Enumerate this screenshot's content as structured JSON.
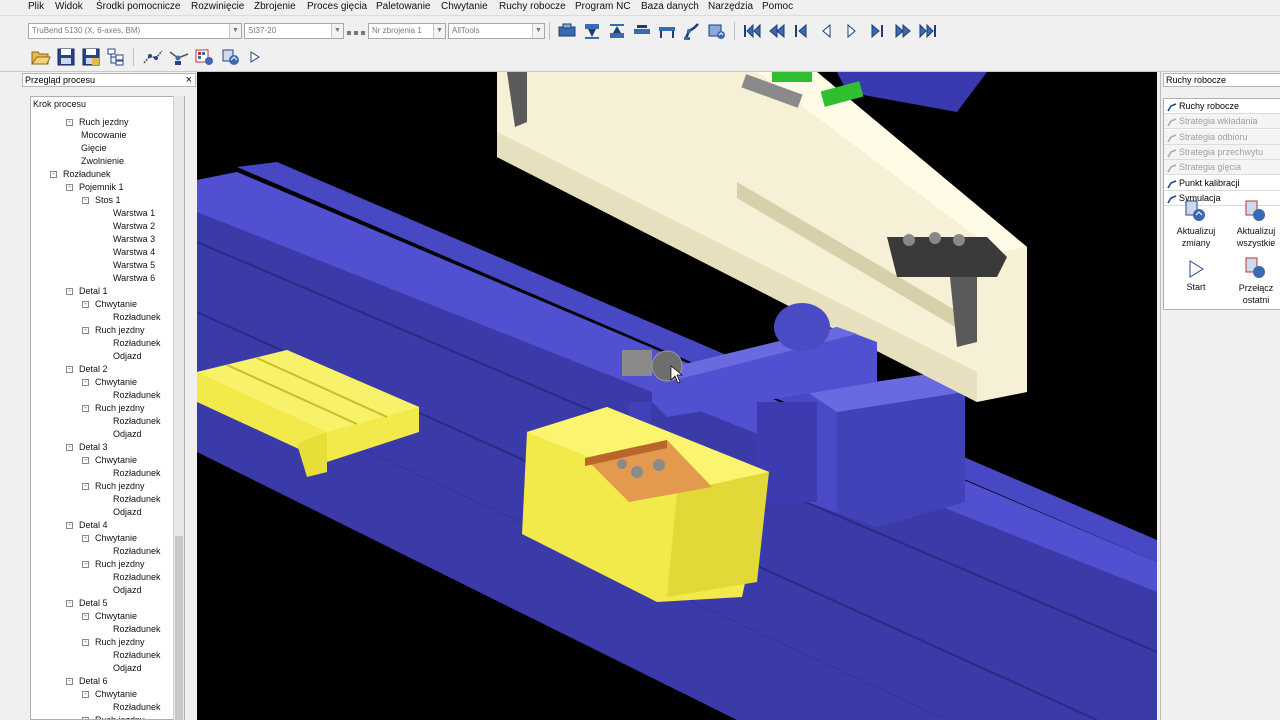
{
  "menu": [
    "Plik",
    "Widok",
    "Środki pomocnicze",
    "Rozwinięcie",
    "Zbrojenie",
    "Proces gięcia",
    "Paletowanie",
    "Chwytanie",
    "Ruchy robocze",
    "Program NC",
    "Baza danych",
    "Narzędzia",
    "Pomoc"
  ],
  "toolbar": {
    "machine_select": "TruBend 5130 (X, 6-axes, BM)",
    "material_select": "St37-20",
    "tooling_number": "Nr zbrojenia 1",
    "tools_select": "AllTools"
  },
  "left_panel": {
    "title": "Przegląd procesu",
    "tree_header": "Krok procesu",
    "tree": [
      {
        "label": "Ruch jezdny",
        "level": 2,
        "toggle": "-"
      },
      {
        "label": "Mocowanie",
        "level": 3
      },
      {
        "label": "Gięcie",
        "level": 3
      },
      {
        "label": "Zwolnienie",
        "level": 3
      },
      {
        "label": "Rozładunek",
        "level": 1,
        "toggle": "-"
      },
      {
        "label": "Pojemnik 1",
        "level": 2,
        "toggle": "-"
      },
      {
        "label": "Stos 1",
        "level": 3,
        "toggle": "-"
      },
      {
        "label": "Warstwa 1",
        "level": 4
      },
      {
        "label": "Warstwa 2",
        "level": 4
      },
      {
        "label": "Warstwa 3",
        "level": 4
      },
      {
        "label": "Warstwa 4",
        "level": 4
      },
      {
        "label": "Warstwa 5",
        "level": 4
      },
      {
        "label": "Warstwa 6",
        "level": 4
      },
      {
        "label": "Detal 1",
        "level": 2,
        "toggle": "-"
      },
      {
        "label": "Chwytanie",
        "level": 3,
        "toggle": "-"
      },
      {
        "label": "Rozładunek",
        "level": 4
      },
      {
        "label": "Ruch jezdny",
        "level": 3,
        "toggle": "-"
      },
      {
        "label": "Rozładunek",
        "level": 4
      },
      {
        "label": "Odjazd",
        "level": 4
      },
      {
        "label": "Detal 2",
        "level": 2,
        "toggle": "-"
      },
      {
        "label": "Chwytanie",
        "level": 3,
        "toggle": "-"
      },
      {
        "label": "Rozładunek",
        "level": 4
      },
      {
        "label": "Ruch jezdny",
        "level": 3,
        "toggle": "-"
      },
      {
        "label": "Rozładunek",
        "level": 4
      },
      {
        "label": "Odjazd",
        "level": 4
      },
      {
        "label": "Detal 3",
        "level": 2,
        "toggle": "-"
      },
      {
        "label": "Chwytanie",
        "level": 3,
        "toggle": "-"
      },
      {
        "label": "Rozładunek",
        "level": 4
      },
      {
        "label": "Ruch jezdny",
        "level": 3,
        "toggle": "-"
      },
      {
        "label": "Rozładunek",
        "level": 4
      },
      {
        "label": "Odjazd",
        "level": 4
      },
      {
        "label": "Detal 4",
        "level": 2,
        "toggle": "-"
      },
      {
        "label": "Chwytanie",
        "level": 3,
        "toggle": "-"
      },
      {
        "label": "Rozładunek",
        "level": 4
      },
      {
        "label": "Ruch jezdny",
        "level": 3,
        "toggle": "-"
      },
      {
        "label": "Rozładunek",
        "level": 4
      },
      {
        "label": "Odjazd",
        "level": 4
      },
      {
        "label": "Detal 5",
        "level": 2,
        "toggle": "-"
      },
      {
        "label": "Chwytanie",
        "level": 3,
        "toggle": "-"
      },
      {
        "label": "Rozładunek",
        "level": 4
      },
      {
        "label": "Ruch jezdny",
        "level": 3,
        "toggle": "-"
      },
      {
        "label": "Rozładunek",
        "level": 4
      },
      {
        "label": "Odjazd",
        "level": 4
      },
      {
        "label": "Detal 6",
        "level": 2,
        "toggle": "-"
      },
      {
        "label": "Chwytanie",
        "level": 3,
        "toggle": "-"
      },
      {
        "label": "Rozładunek",
        "level": 4
      },
      {
        "label": "Ruch jezdny",
        "level": 3,
        "toggle": "-"
      }
    ]
  },
  "right_panel": {
    "title": "Ruchy robocze",
    "items": [
      {
        "label": "Ruchy robocze",
        "disabled": false
      },
      {
        "label": "Strategia wkładania",
        "disabled": true
      },
      {
        "label": "Strategia odbioru",
        "disabled": true
      },
      {
        "label": "Strategia przechwytu",
        "disabled": true
      },
      {
        "label": "Strategia gięcia",
        "disabled": true
      },
      {
        "label": "Punkt kalibracji",
        "disabled": false
      },
      {
        "label": "Symulacja",
        "disabled": false
      }
    ],
    "sim_update": "Aktualizuj zmiany",
    "sim_update_all": "Aktualizuj wszystkie",
    "sim_start": "Start",
    "sim_last": "Przełącz ostatni"
  }
}
